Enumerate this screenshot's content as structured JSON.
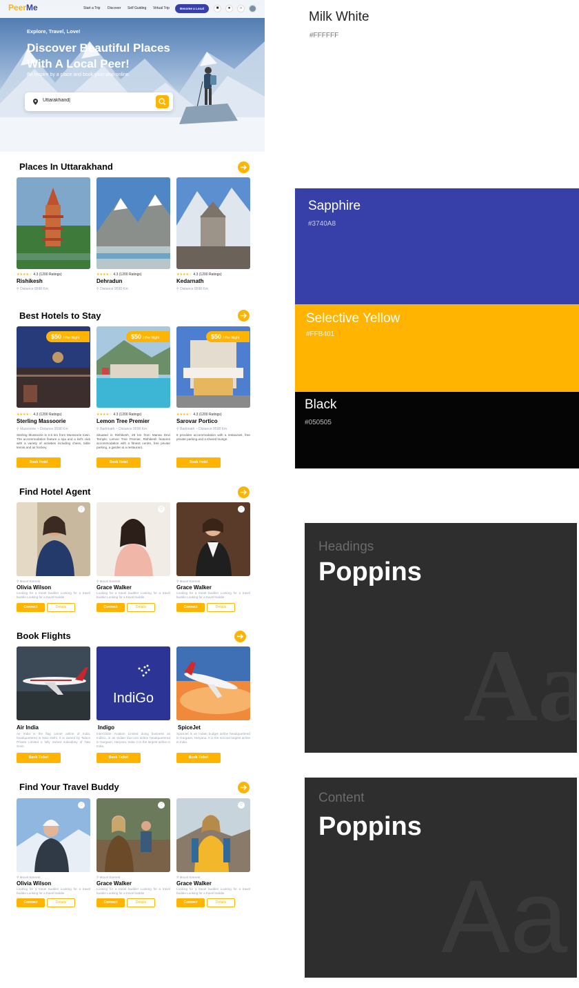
{
  "nav": {
    "logo_part1": "Peer",
    "logo_part2": "Me",
    "links": [
      "Start a Trip",
      "Discover",
      "Self Guiding",
      "Virtual Trip"
    ],
    "cta": "Become a Local"
  },
  "hero": {
    "tagline": "Explore, Travel, Love!",
    "title_line1": "Discover Beautiful Places",
    "title_line2": "With A Local Peer!",
    "subtitle": "Be Inspire by a place and book your stop online.",
    "search_value": "Uttarakhand|"
  },
  "places": {
    "title": "Places In Uttarakhand",
    "items": [
      {
        "name": "Rishikesh",
        "rating": "4.3 (1200 Ratings)",
        "distance": "Distance 9598 Km"
      },
      {
        "name": "Dehradun",
        "rating": "4.3 (1200 Ratings)",
        "distance": "Distance 9598 Km"
      },
      {
        "name": "Kedarnath",
        "rating": "4.3 (1200 Ratings)",
        "distance": "Distance 9598 Km"
      }
    ]
  },
  "hotels": {
    "title": "Best Hotels to Stay",
    "price": "$50",
    "per_night": "/ Per Night",
    "button": "Book Hotel",
    "items": [
      {
        "name": "Sterling Massoorie",
        "rating": "4.3 (1200 Ratings)",
        "location": "Massoorie ~ Distance 9598 Km",
        "desc": "Sterling Mussoorie is 2.6 km from Mussoorie town. The accommodation feature a spa and a kid's club with a variety of activities including chess, table tennis and air hockey."
      },
      {
        "name": "Lemon Tree Premier",
        "rating": "4.3 (1200 Ratings)",
        "location": "Badrinath ~ Distance 9598 Km",
        "desc": "Situated in Rishikesh, 28 km from Mansa Devi Temple, Lemon Tree Premier, Rishikesh features accommodation with a fitness centre, free private parking, a garden & a restaurant."
      },
      {
        "name": "Sarovar Portico",
        "rating": "4.3 (1200 Ratings)",
        "location": "Badrinath ~ Distance 9598 Km",
        "desc": "It provides accommodation with a restaurant, free private parking and a shared lounge."
      }
    ]
  },
  "agents": {
    "title": "Find Hotel Agent",
    "connect": "Connect",
    "details": "Details",
    "items": [
      {
        "location": "Mount Everest",
        "name": "Olivia Wilson",
        "desc": "Looking for a travel buddie! Looking for a travel buddie Looking for a travel buddie"
      },
      {
        "location": "Mount Everest",
        "name": "Grace Walker",
        "desc": "Looking for a travel buddie! Looking for a travel buddie Looking for a travel buddie"
      },
      {
        "location": "Mount Everest",
        "name": "Grace Walker",
        "desc": "Looking for a travel buddie! Looking for a travel buddie Looking for a travel buddie"
      }
    ]
  },
  "flights": {
    "title": "Book Flights",
    "button": "Book Ticket",
    "indigo_logo": "IndiGo",
    "items": [
      {
        "name": "Air India",
        "desc": "Air India is the flag carrier airline of India, headquartered in New Delhi. It is owned by Talace Private Limited a fully owned subsidiary of Tata Sons."
      },
      {
        "name": "Indigo",
        "desc": "InterGlobe Aviation Limited doing business as IndiGo, is an Indian low-cost airline headquartered in Gurgaon, Haryana, India. It is the largest airline in India."
      },
      {
        "name": "SpiceJet",
        "desc": "SpiceJet is an Indian budget airline headquartered in Gurgaon, Haryana. It is the second largest airline in India."
      }
    ]
  },
  "buddy": {
    "title": "Find Your Travel Buddy",
    "connect": "Connect",
    "details": "Details",
    "items": [
      {
        "location": "Mount Everest",
        "name": "Olivia Wilson",
        "desc": "Looking for a travel buddie! Looking for a travel buddie Looking for a travel buddie"
      },
      {
        "location": "Mount Everest",
        "name": "Grace Walker",
        "desc": "Looking for a travel buddie! Looking for a travel buddie Looking for a travel buddie"
      },
      {
        "location": "Mount Everest",
        "name": "Grace Walker",
        "desc": "Looking for a travel buddie! Looking for a travel buddie Looking for a travel buddie"
      }
    ]
  },
  "palette": [
    {
      "name": "Milk White",
      "hex": "#FFFFFF"
    },
    {
      "name": "Sapphire",
      "hex": "#3740A8"
    },
    {
      "name": "Selective Yellow",
      "hex": "#FFB401"
    },
    {
      "name": "Black",
      "hex": "#050505"
    }
  ],
  "typography": [
    {
      "label": "Headings",
      "font": "Poppins",
      "sample": "Aa"
    },
    {
      "label": "Content",
      "font": "Poppins",
      "sample": "Aa"
    }
  ]
}
